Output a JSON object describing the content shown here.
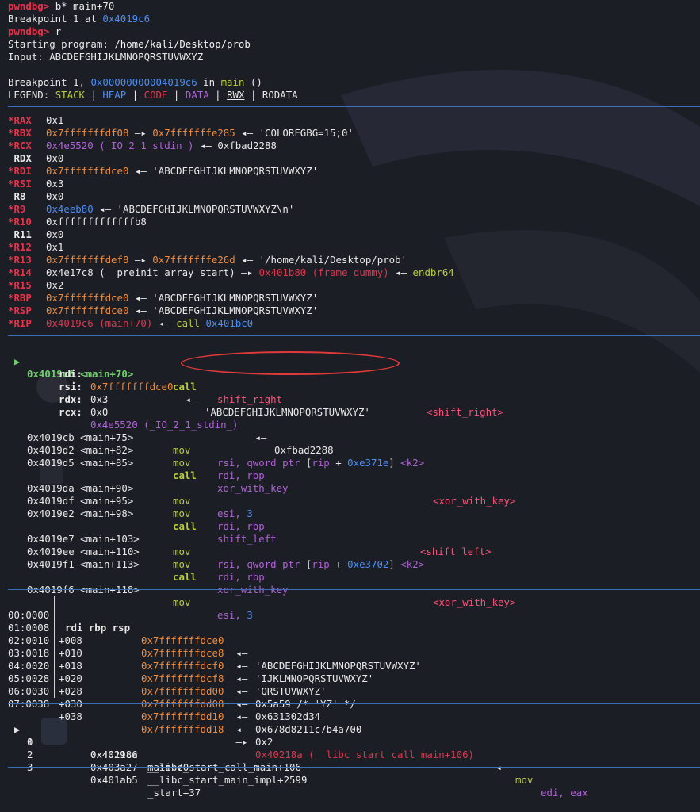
{
  "cmd": {
    "l1_prompt": "pwndbg> ",
    "l1_cmd": "b* main+70",
    "l2_a": "Breakpoint 1 at ",
    "l2_b": "0x4019c6",
    "l3_prompt": "pwndbg> ",
    "l3_cmd": "r",
    "l4_a": "Starting program: ",
    "l4_b": "/home/kali/Desktop/prob",
    "l5": "Input: ABCDEFGHIJKLMNOPQRSTUVWXYZ",
    "l6_a": "Breakpoint 1, ",
    "l6_b": "0x00000000004019c6",
    "l6_c": " in ",
    "l6_d": "main",
    "l6_e": " ()",
    "legend_a": "LEGEND: ",
    "legend_stack": "STACK",
    "legend_heap": "HEAP",
    "legend_code": "CODE",
    "legend_data": "DATA",
    "legend_rwx": "RWX",
    "legend_rodata": "RODATA",
    "legend_sep": " | "
  },
  "registers": {
    "rax_n": "*RAX",
    "rax_v": "0x1",
    "rbx_n": "*RBX",
    "rbx_a": "0x7fffffffdf08",
    "rbx_b": "0x7fffffffe285",
    "rbx_c": "'COLORFGBG=15;0'",
    "rcx_n": "*RCX",
    "rcx_a": "0x4e5520 (_IO_2_1_stdin_)",
    "rcx_b": "0xfbad2288",
    "rdx_n": " RDX",
    "rdx_v": "0x0",
    "rdi_n": "*RDI",
    "rdi_a": "0x7fffffffdce0",
    "rdi_b": "'ABCDEFGHIJKLMNOPQRSTUVWXYZ'",
    "rsi_n": "*RSI",
    "rsi_v": "0x3",
    "r8_n": " R8",
    "r8_v": "0x0",
    "r9_n": "*R9",
    "r9_a": "0x4eeb80",
    "r9_b": "'ABCDEFGHIJKLMNOPQRSTUVWXYZ\\n'",
    "r10_n": "*R10",
    "r10_v": "0xfffffffffffffb8",
    "r11_n": " R11",
    "r11_v": "0x0",
    "r12_n": "*R12",
    "r12_v": "0x1",
    "r13_n": "*R13",
    "r13_a": "0x7fffffffdef8",
    "r13_b": "0x7fffffffe26d",
    "r13_c": "'/home/kali/Desktop/prob'",
    "r14_n": "*R14",
    "r14_a": "0x4e17c8 (__preinit_array_start)",
    "r14_b": "0x401b80 (frame_dummy)",
    "r14_c": "endbr64",
    "r15_n": "*R15",
    "r15_v": "0x2",
    "rbp_n": "*RBP",
    "rbp_a": "0x7fffffffdce0",
    "rbp_b": "'ABCDEFGHIJKLMNOPQRSTUVWXYZ'",
    "rsp_n": "*RSP",
    "rsp_a": "0x7fffffffdce0",
    "rsp_b": "'ABCDEFGHIJKLMNOPQRSTUVWXYZ'",
    "rip_n": "*RIP",
    "rip_a": "0x4019c6 (main+70)",
    "rip_b": "call",
    "rip_c": "0x401bc0",
    "arrow": " —▸ ",
    "larrow": " ◂— "
  },
  "disasm": {
    "cur_marker": "▶",
    "cur_addr": "0x4019c6 <main+70>",
    "cur_op": "call",
    "cur_arg": "shift_right",
    "cur_sym": "<shift_right>",
    "a_rdi": "rdi:",
    "a_rdi_v": "0x7fffffffdce0",
    "a_rdi_s": "'ABCDEFGHIJKLMNOPQRSTUVWXYZ'",
    "a_rsi": "rsi:",
    "a_rsi_v": "0x3",
    "a_rdx": "rdx:",
    "a_rdx_v": "0x0",
    "a_rcx": "rcx:",
    "a_rcx_v": "0x4e5520 (_IO_2_1_stdin_)",
    "a_rcx_s": "0xfbad2288",
    "rows": [
      {
        "addr": "0x4019cb <main+75>",
        "op": "mov",
        "a": "rsi, ",
        "b": "qword ptr",
        "c": " [",
        "d": "rip",
        "e": " + ",
        "f": "0xe371e",
        "g": "] ",
        "h": "<k2>"
      },
      {
        "addr": "0x4019d2 <main+82>",
        "op": "mov",
        "a": "rdi, rbp"
      },
      {
        "addr": "0x4019d5 <main+85>",
        "op": "call",
        "a": "xor_with_key",
        "sym": "<xor_with_key>"
      },
      {
        "addr": "0x4019da <main+90>",
        "op": "mov",
        "a": "esi, ",
        "n": "3"
      },
      {
        "addr": "0x4019df <main+95>",
        "op": "mov",
        "a": "rdi, rbp"
      },
      {
        "addr": "0x4019e2 <main+98>",
        "op": "call",
        "a": "shift_left",
        "sym": "<shift_left>"
      },
      {
        "addr": "0x4019e7 <main+103>",
        "op": "mov",
        "a": "rsi, ",
        "b": "qword ptr",
        "c": " [",
        "d": "rip",
        "e": " + ",
        "f": "0xe3702",
        "g": "] ",
        "h": "<k2>"
      },
      {
        "addr": "0x4019ee <main+110>",
        "op": "mov",
        "a": "rdi, rbp"
      },
      {
        "addr": "0x4019f1 <main+113>",
        "op": "call",
        "a": "xor_with_key",
        "sym": "<xor_with_key>"
      },
      {
        "addr": "0x4019f6 <main+118>",
        "op": "mov",
        "a": "esi, ",
        "n": "3"
      }
    ]
  },
  "stack": {
    "rows": [
      {
        "idx": "00:0000",
        "off": "",
        "regs": "rdi rbp rsp",
        "addr": "0x7fffffffdce0",
        "val": "'ABCDEFGHIJKLMNOPQRSTUVWXYZ'"
      },
      {
        "idx": "01:0008",
        "off": "+008",
        "addr": "0x7fffffffdce8",
        "val": "'IJKLMNOPQRSTUVWXYZ'"
      },
      {
        "idx": "02:0010",
        "off": "+010",
        "addr": "0x7fffffffdcf0",
        "val": "'QRSTUVWXYZ'"
      },
      {
        "idx": "03:0018",
        "off": "+018",
        "addr": "0x7fffffffdcf8",
        "val": "0x5a59 /* 'YZ' */"
      },
      {
        "idx": "04:0020",
        "off": "+020",
        "addr": "0x7fffffffdd00",
        "val": "0x631302d34"
      },
      {
        "idx": "05:0028",
        "off": "+028",
        "addr": "0x7fffffffdd08",
        "val": "0x678d8211c7b4a700"
      },
      {
        "idx": "06:0030",
        "off": "+030",
        "addr": "0x7fffffffdd10",
        "val": "0x2"
      },
      {
        "idx": "07:0038",
        "off": "+038",
        "addr": "0x7fffffffdd18",
        "val": "0x40218a (__libc_start_call_main+106)",
        "op": "mov",
        "ops": "edi, eax"
      }
    ]
  },
  "backtrace": {
    "rows": [
      {
        "mark": "▶",
        "n": "0",
        "addr": "0x4019c6",
        "sym": "main+70"
      },
      {
        "mark": "",
        "n": "1",
        "addr": "0x40218a",
        "sym": "__libc_start_call_main+106"
      },
      {
        "mark": "",
        "n": "2",
        "addr": "0x403a27",
        "sym": "__libc_start_main_impl+2599"
      },
      {
        "mark": "",
        "n": "3",
        "addr": "0x401ab5",
        "sym": "_start+37"
      }
    ]
  }
}
